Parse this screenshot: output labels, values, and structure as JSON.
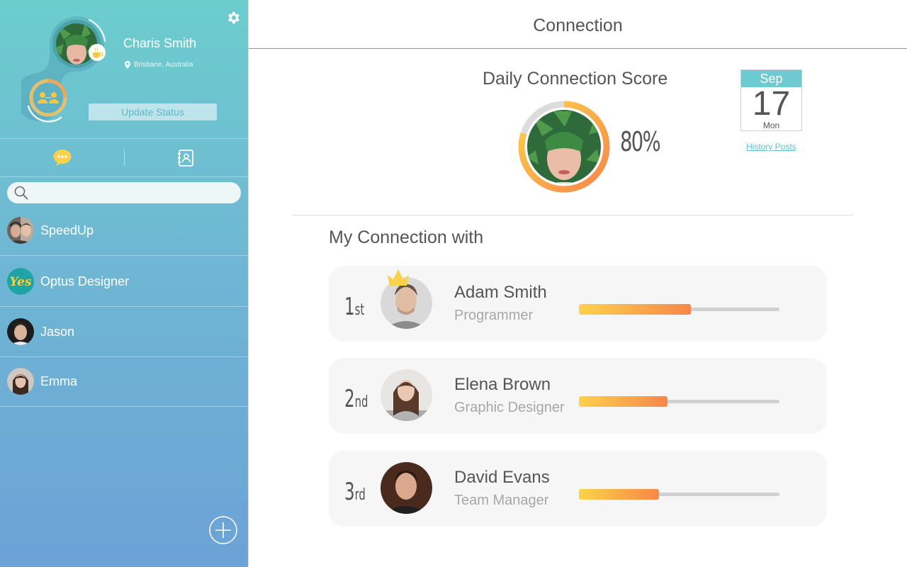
{
  "sidebar": {
    "profile": {
      "name": "Charis Smith",
      "location": "Brisbane, Australia"
    },
    "update_status_label": "Update Status",
    "search": {
      "placeholder": "",
      "value": ""
    },
    "contacts": [
      {
        "name": "SpeedUp"
      },
      {
        "name": "Optus Designer",
        "avatar_text": "Yes"
      },
      {
        "name": "Jason"
      },
      {
        "name": "Emma"
      }
    ],
    "colors": {
      "gradient_top": "#6ccdcd",
      "gradient_bottom": "#6ca2d6",
      "chat_icon": "#f8d24a"
    }
  },
  "main": {
    "title": "Connection",
    "score": {
      "title": "Daily Connection Score",
      "percent_label": "80%",
      "value": 0.8
    },
    "calendar": {
      "month": "Sep",
      "day": "17",
      "weekday": "Mon"
    },
    "history_link": "History Posts",
    "section_title": "My Connection with",
    "connections": [
      {
        "rank_num": "1",
        "rank_suffix": "st",
        "name": "Adam Smith",
        "role": "Programmer",
        "score": 0.56,
        "crown": true
      },
      {
        "rank_num": "2",
        "rank_suffix": "nd",
        "name": "Elena Brown",
        "role": "Graphic Designer",
        "score": 0.44,
        "crown": false
      },
      {
        "rank_num": "3",
        "rank_suffix": "rd",
        "name": "David Evans",
        "role": "Team Manager",
        "score": 0.4,
        "crown": false
      }
    ],
    "colors": {
      "bar_start": "#fdd24a",
      "bar_end": "#f7874a",
      "accent": "#6dcad0"
    }
  }
}
